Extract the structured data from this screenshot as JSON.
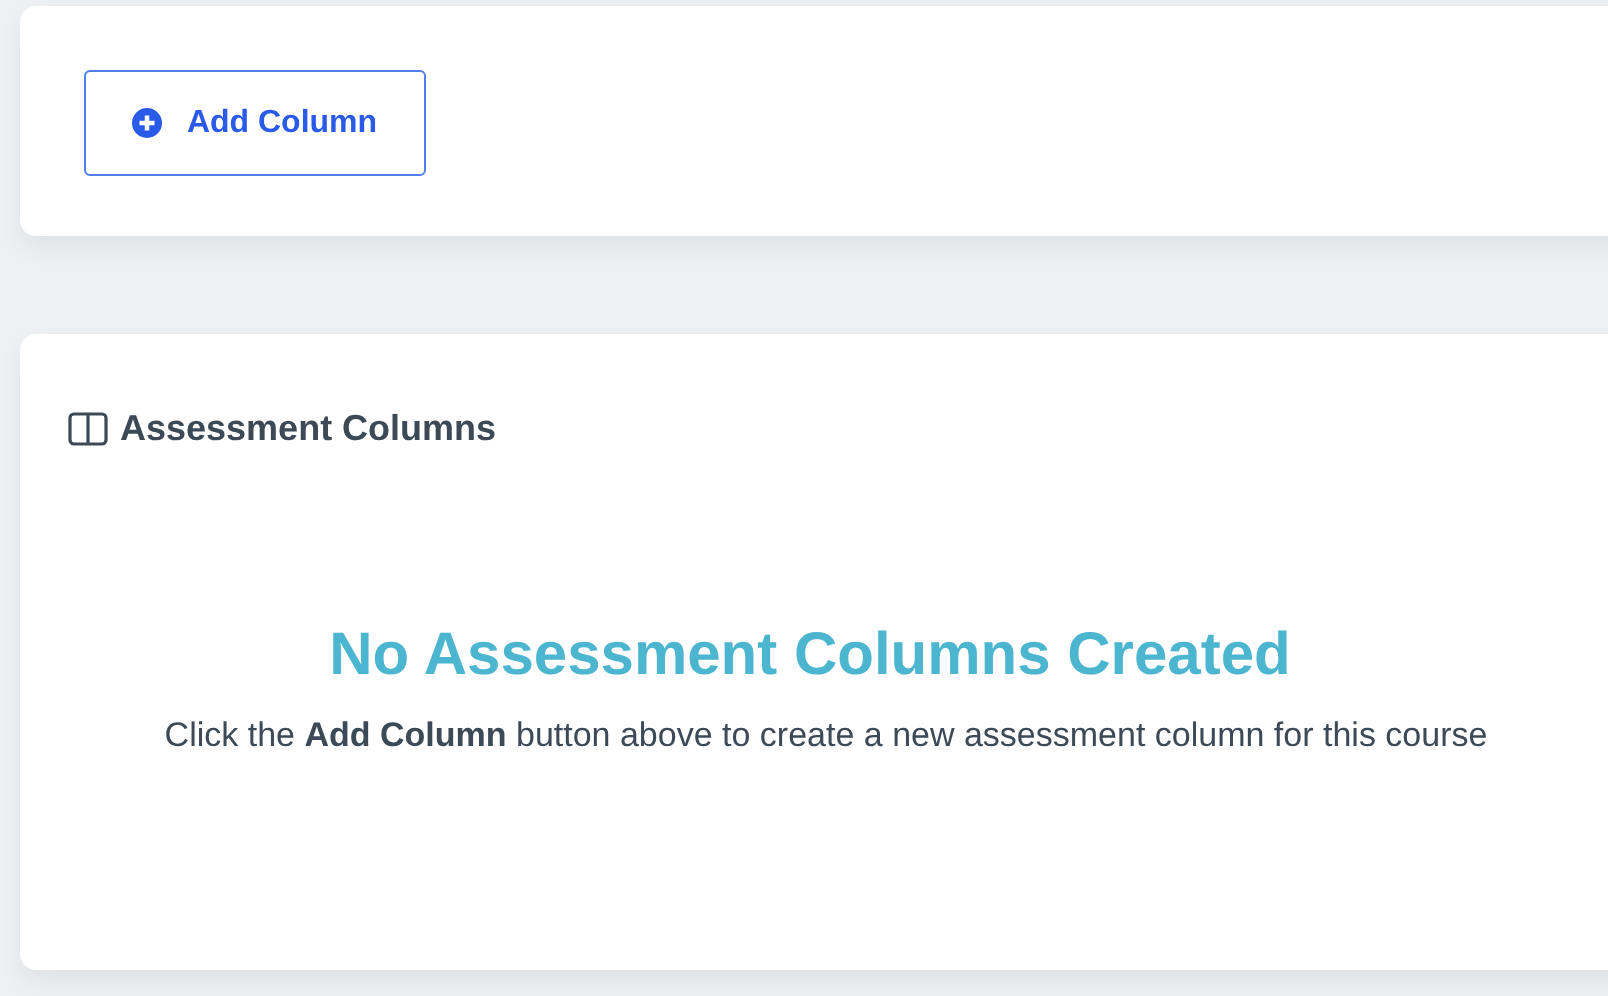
{
  "toolbar": {
    "add_button": {
      "label": "Add Column"
    }
  },
  "panel": {
    "title": "Assessment Columns",
    "empty_state": {
      "heading": "No Assessment Columns Created",
      "message": "Click the **Add Column** button above to create a new assessment column for this course"
    }
  }
}
